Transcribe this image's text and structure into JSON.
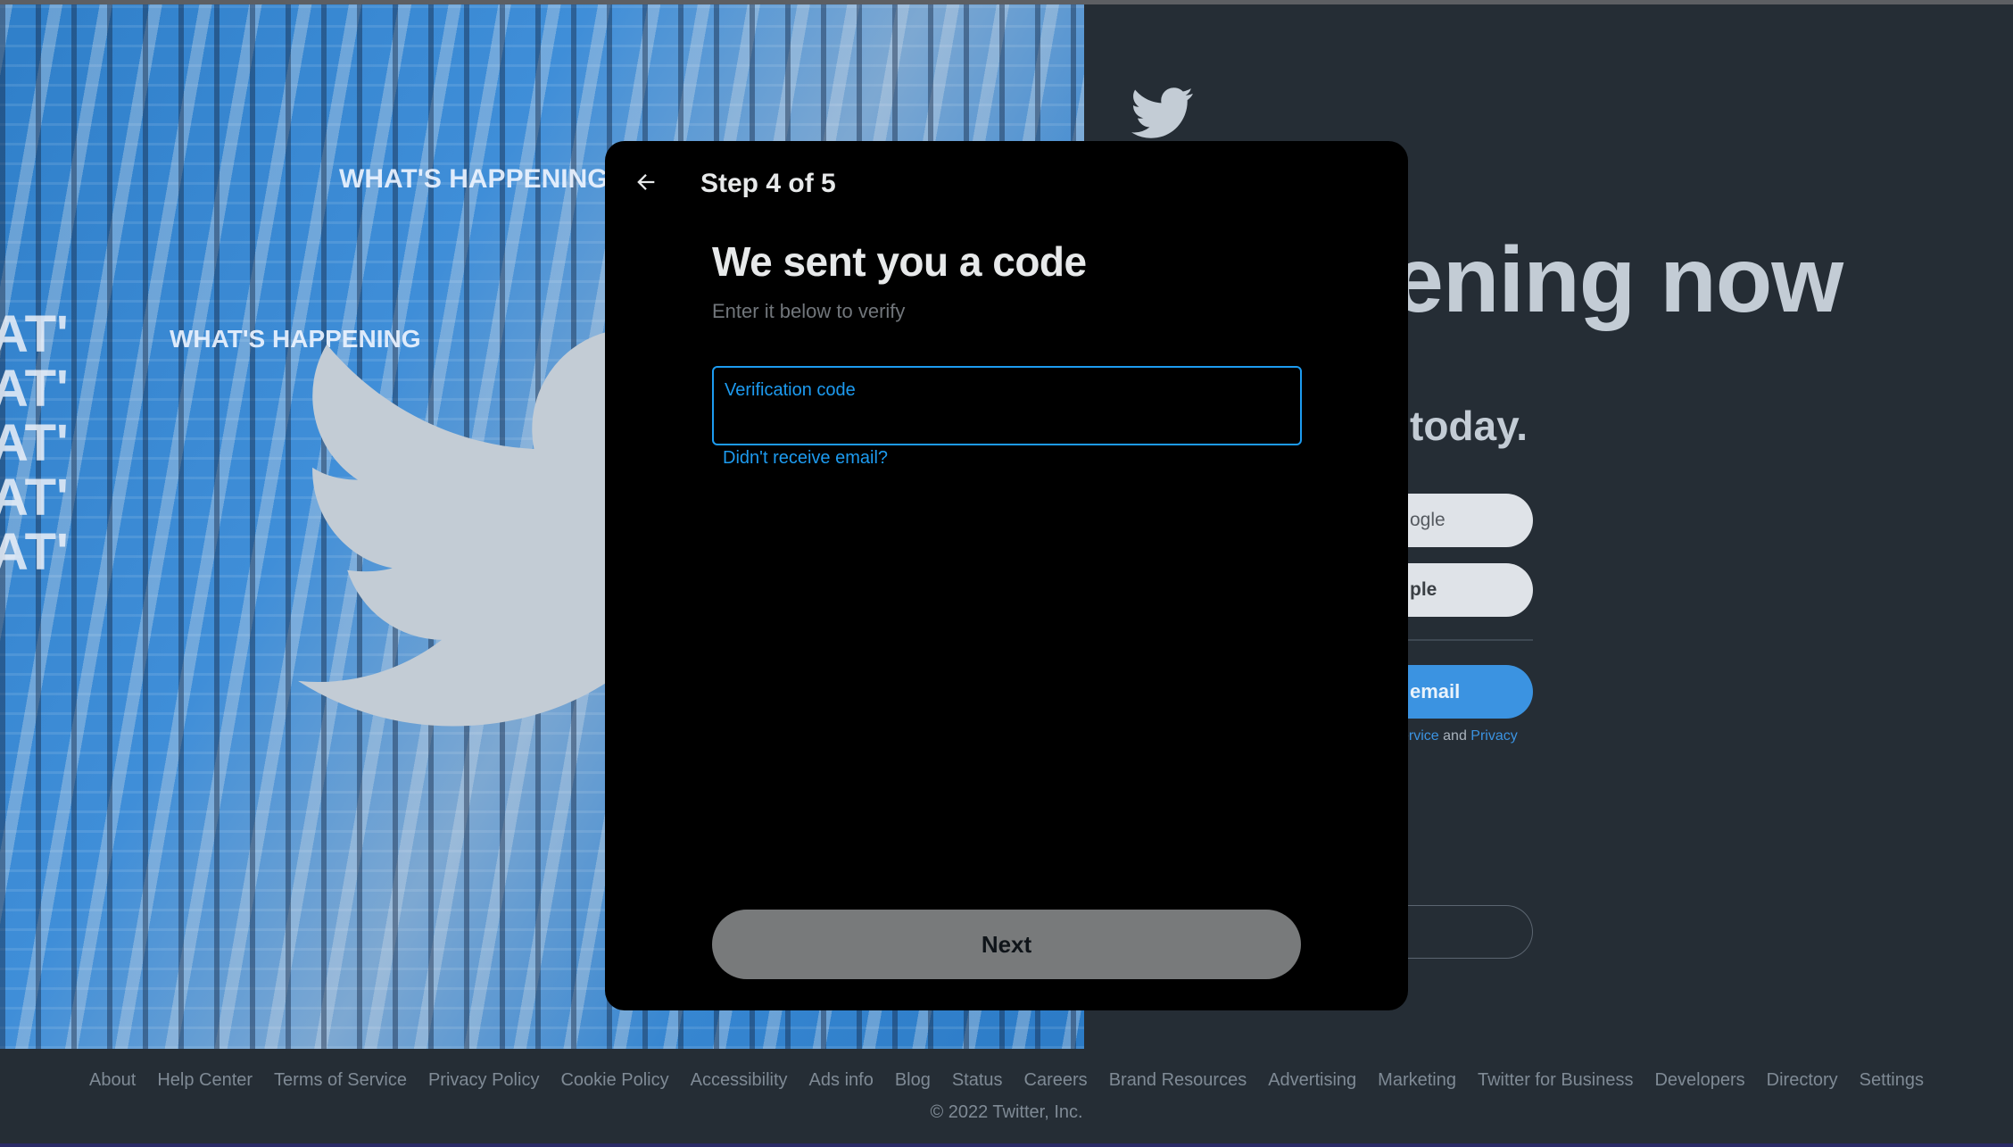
{
  "modal": {
    "step_title": "Step 4 of 5",
    "heading": "We sent you a code",
    "subheading": "Enter it below to verify",
    "code_field": {
      "label": "Verification code",
      "value": ""
    },
    "resend_link": "Didn't receive email?",
    "next_label": "Next",
    "back_icon": "arrow-left-icon"
  },
  "background": {
    "headline_partial": "ening now",
    "sub_partial": "today.",
    "google_btn_partial": "ogle",
    "apple_btn_partial": "ple",
    "email_btn_partial": "email",
    "terms_partial_link1": "ervice",
    "terms_and": "and",
    "terms_partial_link2": "Privacy",
    "hero_text": "WHAT'S HAPPENING"
  },
  "footer": {
    "links": [
      "About",
      "Help Center",
      "Terms of Service",
      "Privacy Policy",
      "Cookie Policy",
      "Accessibility",
      "Ads info",
      "Blog",
      "Status",
      "Careers",
      "Brand Resources",
      "Advertising",
      "Marketing",
      "Twitter for Business",
      "Developers",
      "Directory",
      "Settings"
    ],
    "copyright": "© 2022 Twitter, Inc."
  },
  "colors": {
    "accent": "#1d9bf0",
    "page_bg": "#252d35",
    "modal_bg": "#000000",
    "next_button": "#787a7b"
  }
}
